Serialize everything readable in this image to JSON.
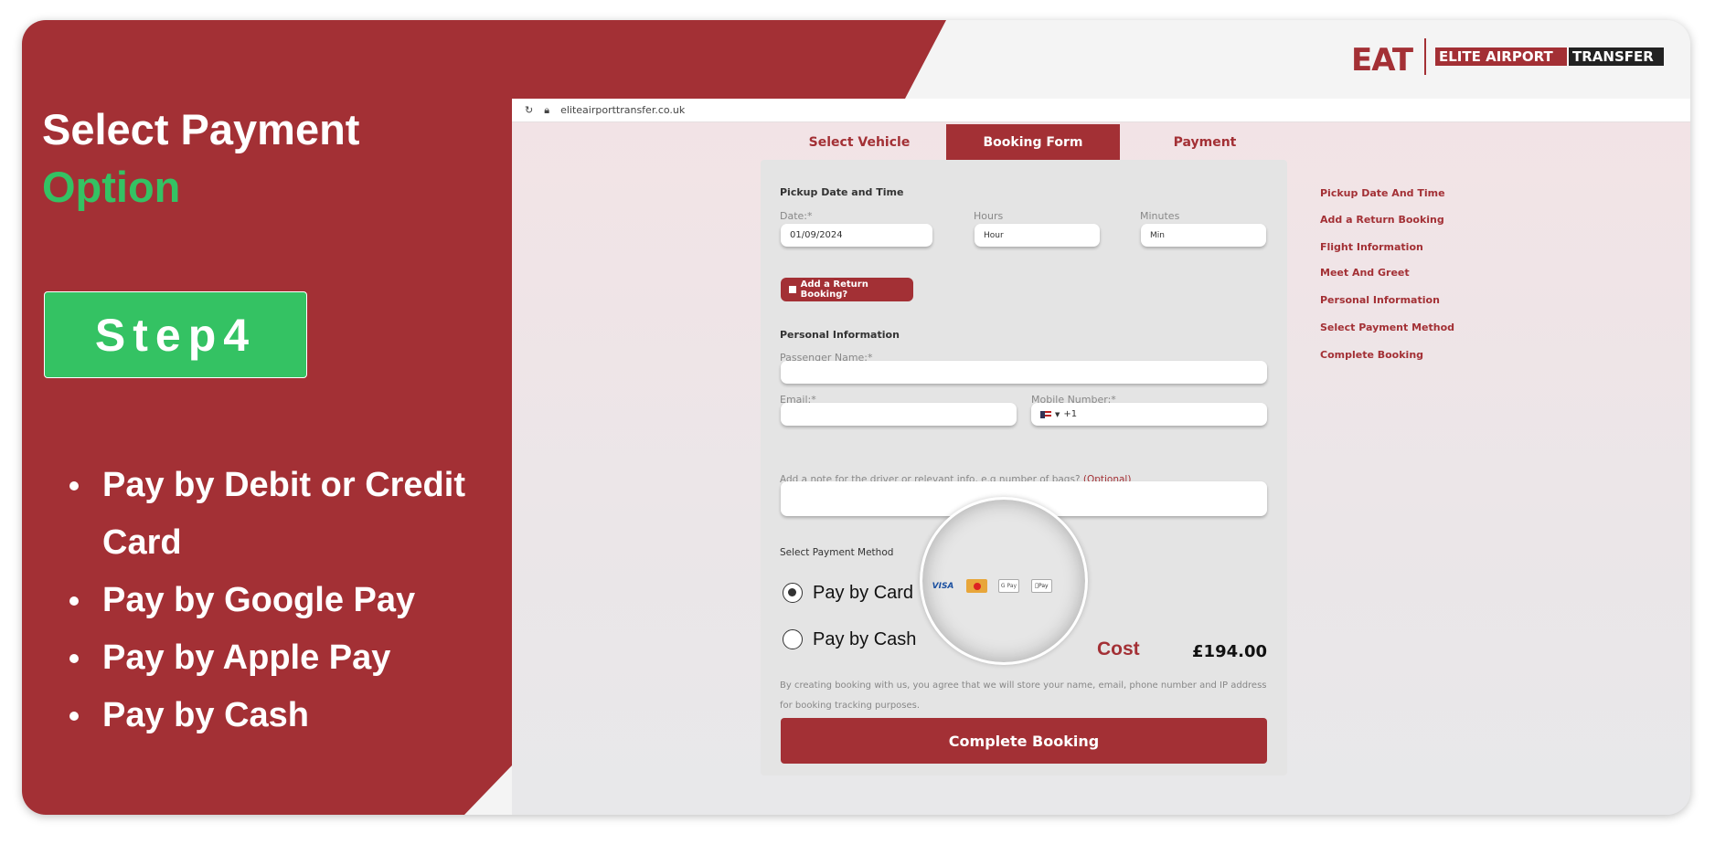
{
  "colors": {
    "brand_red": "#a33035",
    "accent_green": "#34c263"
  },
  "promo": {
    "title_line1": "Select Payment",
    "title_line2": "Option",
    "step_label": "Step4",
    "bullets": [
      "Pay by Debit or Credit Card",
      "Pay by Google Pay",
      "Pay by Apple Pay",
      "Pay by Cash"
    ]
  },
  "logo": {
    "mark": "EAT",
    "text_red": "ELITE AIRPORT",
    "text_black": "TRANSFER"
  },
  "browser": {
    "url": "eliteairporttransfer.co.uk",
    "reload_icon": "reload-icon",
    "lock_icon": "lock-icon"
  },
  "tabs": [
    {
      "label": "Select Vehicle",
      "active": false
    },
    {
      "label": "Booking Form",
      "active": true
    },
    {
      "label": "Payment",
      "active": false
    }
  ],
  "form": {
    "pickup_heading": "Pickup Date and Time",
    "date_label": "Date:*",
    "date_value": "01/09/2024",
    "hours_label": "Hours",
    "hours_value": "Hour",
    "minutes_label": "Minutes",
    "minutes_value": "Min",
    "return_booking_label": "Add a Return Booking?",
    "personal_heading": "Personal Information",
    "passenger_label": "Passenger Name:*",
    "passenger_value": "",
    "email_label": "Email:*",
    "email_value": "",
    "mobile_label": "Mobile Number:*",
    "mobile_code": "+1",
    "note_label": "Add a note for the driver or relevant info, e.g number of bags?",
    "note_optional": "(Optional)",
    "payment_heading": "Select Payment Method",
    "payment_options": [
      {
        "label": "Pay by Card",
        "selected": true
      },
      {
        "label": "Pay by Cash",
        "selected": false
      }
    ],
    "payment_icons": [
      "VISA",
      "Mastercard",
      "G Pay",
      "Apple Pay"
    ],
    "cost_label": "Cost",
    "cost_value": "£194.00",
    "disclaimer_line1": "By creating booking with us, you agree that we will store your name, email, phone number and IP address",
    "disclaimer_line2": "for booking tracking purposes.",
    "submit_label": "Complete Booking"
  },
  "sidebar_links": [
    "Pickup Date And Time",
    "Add a Return Booking",
    "Flight Information",
    "Meet And Greet",
    "Personal Information",
    "Select Payment Method",
    "Complete Booking"
  ]
}
